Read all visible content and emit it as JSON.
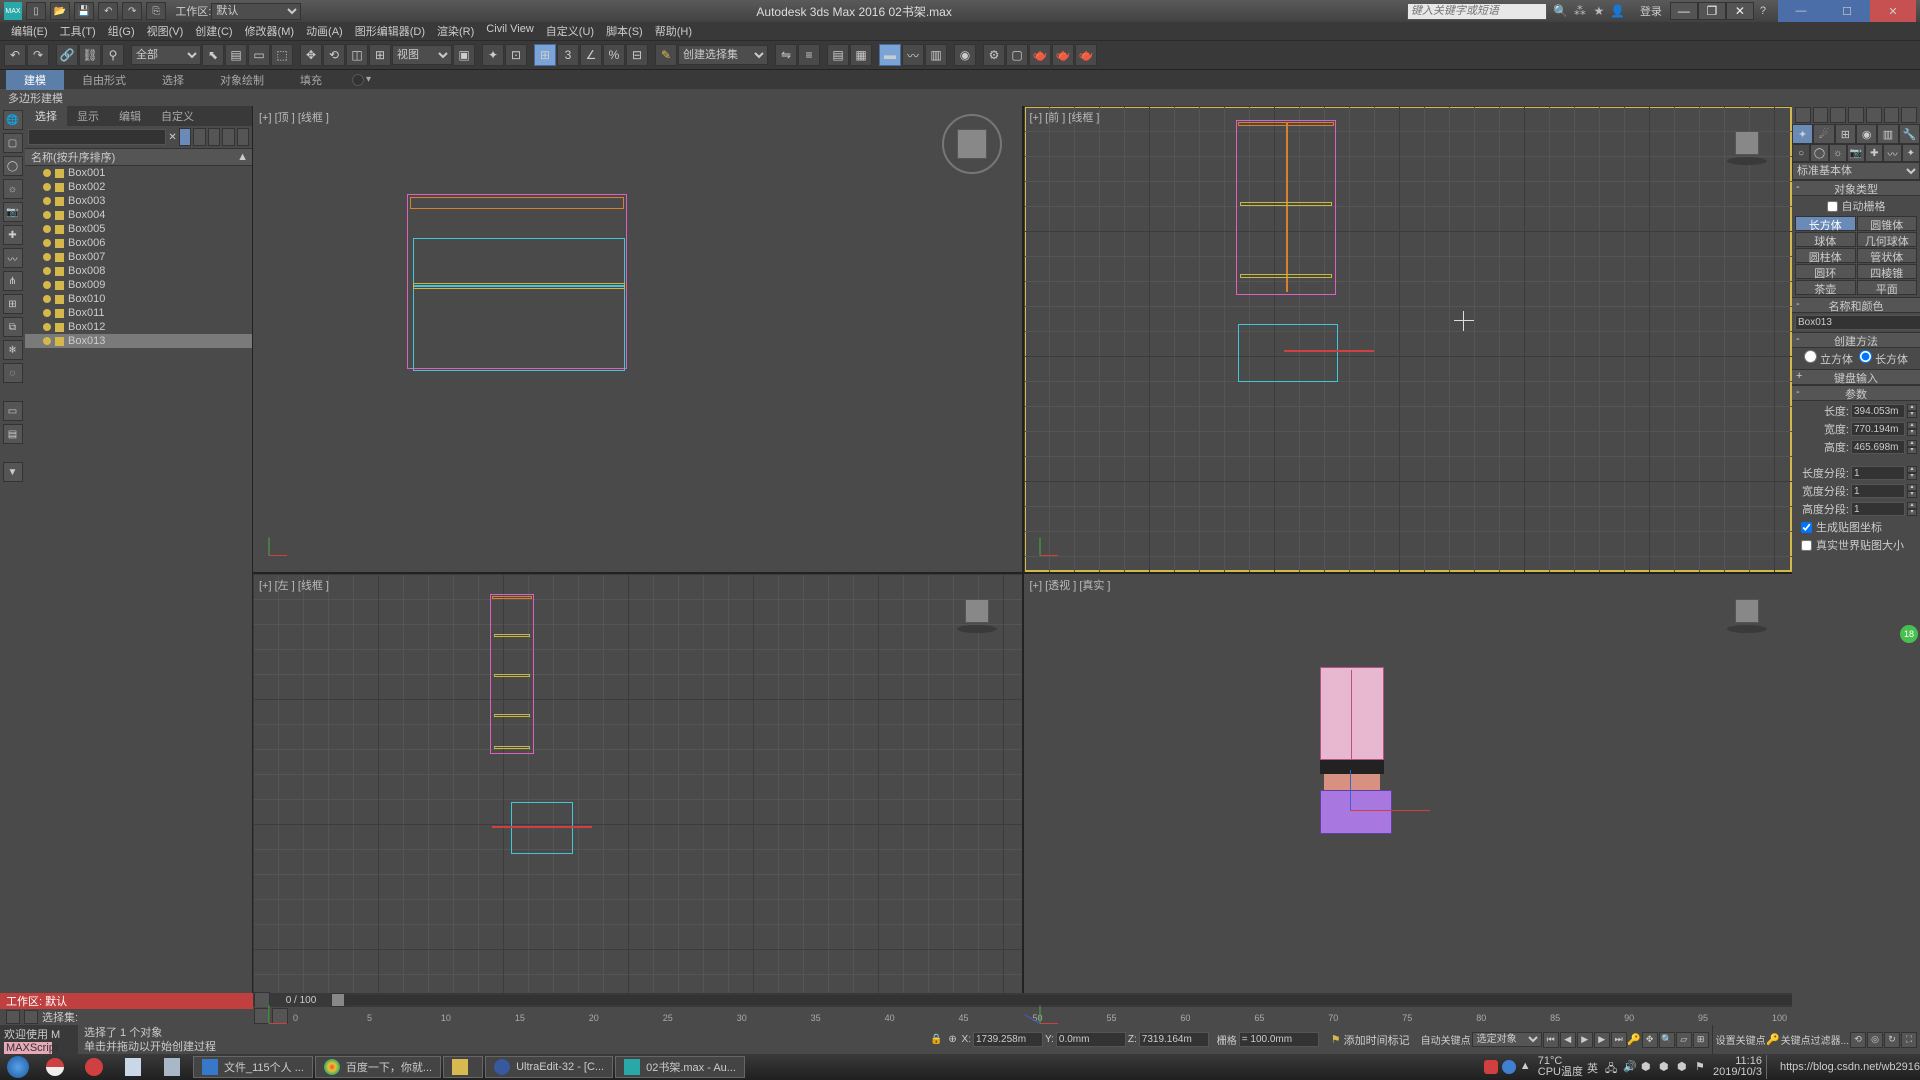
{
  "titlebar": {
    "workspace_label": "工作区:",
    "workspace_value": "默认",
    "app_title": "Autodesk 3ds Max 2016    02书架.max",
    "search_placeholder": "键入关键字或短语",
    "login": "登录"
  },
  "menubar": [
    "编辑(E)",
    "工具(T)",
    "组(G)",
    "视图(V)",
    "创建(C)",
    "修改器(M)",
    "动画(A)",
    "图形编辑器(D)",
    "渲染(R)",
    "Civil View",
    "自定义(U)",
    "脚本(S)",
    "帮助(H)"
  ],
  "ribbon": {
    "tabs": [
      "建模",
      "自由形式",
      "选择",
      "对象绘制",
      "填充"
    ],
    "sub": "多边形建模"
  },
  "toolbar": {
    "all_filter": "全部",
    "view_mode": "视图",
    "create_set": "创建选择集"
  },
  "explorer": {
    "tabs": [
      "选择",
      "显示",
      "编辑",
      "自定义"
    ],
    "header": "名称(按升序排序)",
    "items": [
      "Box001",
      "Box002",
      "Box003",
      "Box004",
      "Box005",
      "Box006",
      "Box007",
      "Box008",
      "Box009",
      "Box010",
      "Box011",
      "Box012",
      "Box013"
    ],
    "selected_index": 12
  },
  "viewports": {
    "top": "[+] [顶 ] [线框 ]",
    "front": "[+] [前 ] [线框 ]",
    "left": "[+] [左 ] [线框 ]",
    "persp": "[+] [透视 ] [真实 ]"
  },
  "cmd": {
    "dropdown": "标准基本体",
    "rollout_type": "对象类型",
    "auto_grid": "自动栅格",
    "primitives": [
      "长方体",
      "圆锥体",
      "球体",
      "几何球体",
      "圆柱体",
      "管状体",
      "圆环",
      "四棱锥",
      "茶壶",
      "平面"
    ],
    "rollout_name": "名称和颜色",
    "object_name": "Box013",
    "rollout_create": "创建方法",
    "radio_cube": "立方体",
    "radio_box": "长方体",
    "rollout_kbd": "键盘输入",
    "rollout_params": "参数",
    "p_length_l": "长度:",
    "p_length_v": "394.053m",
    "p_width_l": "宽度:",
    "p_width_v": "770.194m",
    "p_height_l": "高度:",
    "p_height_v": "465.698m",
    "p_lseg_l": "长度分段:",
    "p_lseg_v": "1",
    "p_wseg_l": "宽度分段:",
    "p_wseg_v": "1",
    "p_hseg_l": "高度分段:",
    "p_hseg_v": "1",
    "chk_genuv": "生成贴图坐标",
    "chk_realworld": "真实世界贴图大小"
  },
  "timeline": {
    "pos_label": "0 / 100",
    "ticks": [
      "0",
      "5",
      "10",
      "15",
      "20",
      "25",
      "30",
      "35",
      "40",
      "45",
      "50",
      "55",
      "60",
      "65",
      "70",
      "75",
      "80",
      "85",
      "90",
      "95",
      "100"
    ]
  },
  "workspace_panel": {
    "header": "工作区: 默认",
    "select_set": "选择集:"
  },
  "status": {
    "maxscript1": "欢迎使用 M",
    "maxscript2": "MAXScript",
    "sel": "选择了 1 个对象",
    "hint": "单击并拖动以开始创建过程",
    "x_l": "X:",
    "x_v": "1739.258m",
    "y_l": "Y:",
    "y_v": "0.0mm",
    "z_l": "Z:",
    "z_v": "7319.164m",
    "grid_l": "栅格",
    "grid_v": "= 100.0mm",
    "addtag": "添加时间标记",
    "autokey": "自动关键点",
    "setkey": "设置关键点",
    "sel_obj": "选定对象",
    "keyfilter": "关键点过滤器..."
  },
  "taskbar": {
    "tasks": [
      "文件_115个人 ...",
      "百度一下，你就...",
      "",
      "UltraEdit-32 - [C...",
      "02书架.max - Au..."
    ],
    "temp_v": "71°C",
    "temp_l": "CPU温度",
    "time": "11:16",
    "date": "2019/10/3",
    "watermark": "https://blog.csdn.net/wb2916"
  },
  "float_badge": "18"
}
